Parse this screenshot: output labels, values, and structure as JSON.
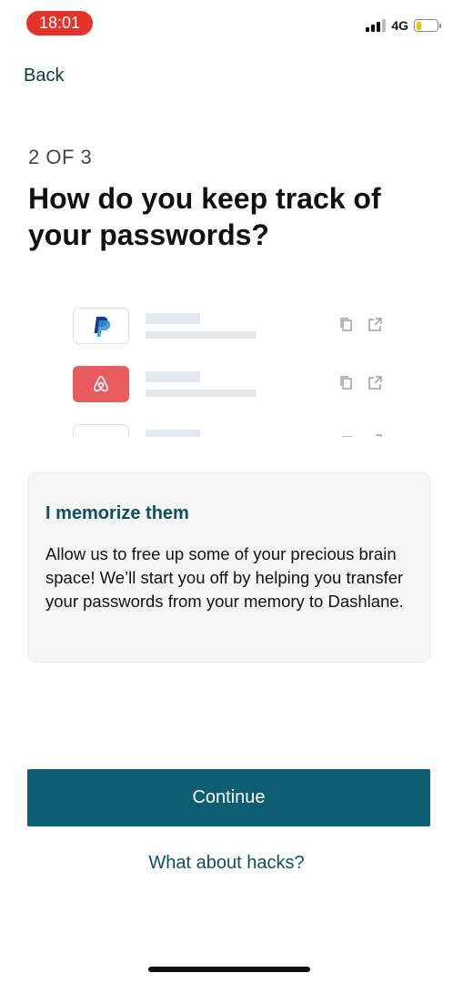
{
  "status_bar": {
    "time": "18:01",
    "network": "4G",
    "battery_level": 0.25,
    "colors": {
      "time_pill": "#e3332b",
      "battery": "#f2c100"
    }
  },
  "nav": {
    "back_label": "Back"
  },
  "step": {
    "label": "2 OF 3"
  },
  "title": "How do you keep track of your passwords?",
  "illustration": {
    "rows": [
      {
        "logo": "paypal-logo",
        "color": "#ffffff"
      },
      {
        "logo": "airbnb-logo",
        "color": "#e85b5e"
      },
      {
        "logo": "blank-logo",
        "color": "#ffffff"
      }
    ],
    "row_icons": [
      "copy-icon",
      "open-external-icon"
    ]
  },
  "card": {
    "heading": "I memorize them",
    "body": "Allow us to free up some of your precious brain space! We’ll start you off by helping you transfer your passwords from your memory to Dashlane."
  },
  "actions": {
    "continue_label": "Continue",
    "secondary_link": "What about hacks?",
    "primary_color": "#0e5e73"
  }
}
